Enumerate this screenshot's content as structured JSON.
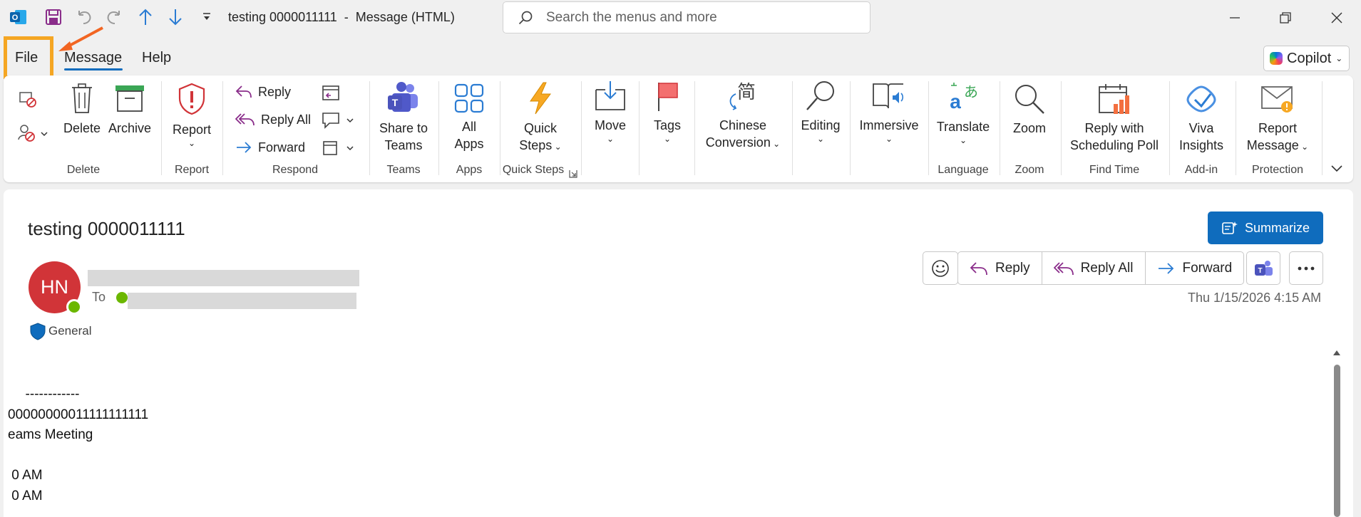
{
  "titlebar": {
    "title": "testing 0000011111  -  Message (HTML)",
    "search_placeholder": "Search the menus and more",
    "icons": [
      "outlook-icon",
      "save-icon",
      "undo-icon",
      "redo-icon",
      "up-arrow-icon",
      "down-arrow-icon",
      "customize-icon"
    ]
  },
  "tabs": {
    "file": "File",
    "message": "Message",
    "help": "Help"
  },
  "copilot": {
    "label": "Copilot"
  },
  "ribbon": {
    "delete_group": {
      "delete": "Delete",
      "archive": "Archive",
      "label": "Delete"
    },
    "report_group": {
      "report": "Report",
      "label": "Report"
    },
    "respond_group": {
      "reply": "Reply",
      "reply_all": "Reply All",
      "forward": "Forward",
      "label": "Respond"
    },
    "teams_group": {
      "share_line1": "Share to",
      "share_line2": "Teams",
      "label": "Teams"
    },
    "apps_group": {
      "line1": "All",
      "line2": "Apps",
      "label": "Apps"
    },
    "quicksteps_group": {
      "line1": "Quick",
      "line2": "Steps",
      "label": "Quick Steps"
    },
    "move": "Move",
    "tags": "Tags",
    "chinese": {
      "line1": "Chinese",
      "line2": "Conversion"
    },
    "editing": "Editing",
    "immersive": "Immersive",
    "language_group": {
      "translate": "Translate",
      "label": "Language"
    },
    "zoom_group": {
      "zoom": "Zoom",
      "label": "Zoom"
    },
    "findtime_group": {
      "line1": "Reply with",
      "line2": "Scheduling Poll",
      "label": "Find Time"
    },
    "addin_group": {
      "line1": "Viva",
      "line2": "Insights",
      "label": "Add-in"
    },
    "protection_group": {
      "line1": "Report",
      "line2": "Message",
      "label": "Protection"
    }
  },
  "message": {
    "subject": "testing 0000011111",
    "summarize": "Summarize",
    "avatar_initials": "HN",
    "to_label": "To",
    "sensitivity": "General",
    "actions": {
      "reply": "Reply",
      "reply_all": "Reply All",
      "forward": "Forward"
    },
    "date": "Thu 1/15/2026 4:15 AM",
    "body_lines": [
      "  ------------",
      "00000000011111111111",
      "eams Meeting",
      " 0 AM",
      " 0 AM"
    ]
  },
  "colors": {
    "accent": "#0f6cbd",
    "avatar": "#d13438",
    "highlight": "#f5a623",
    "presence": "#6bb700"
  }
}
